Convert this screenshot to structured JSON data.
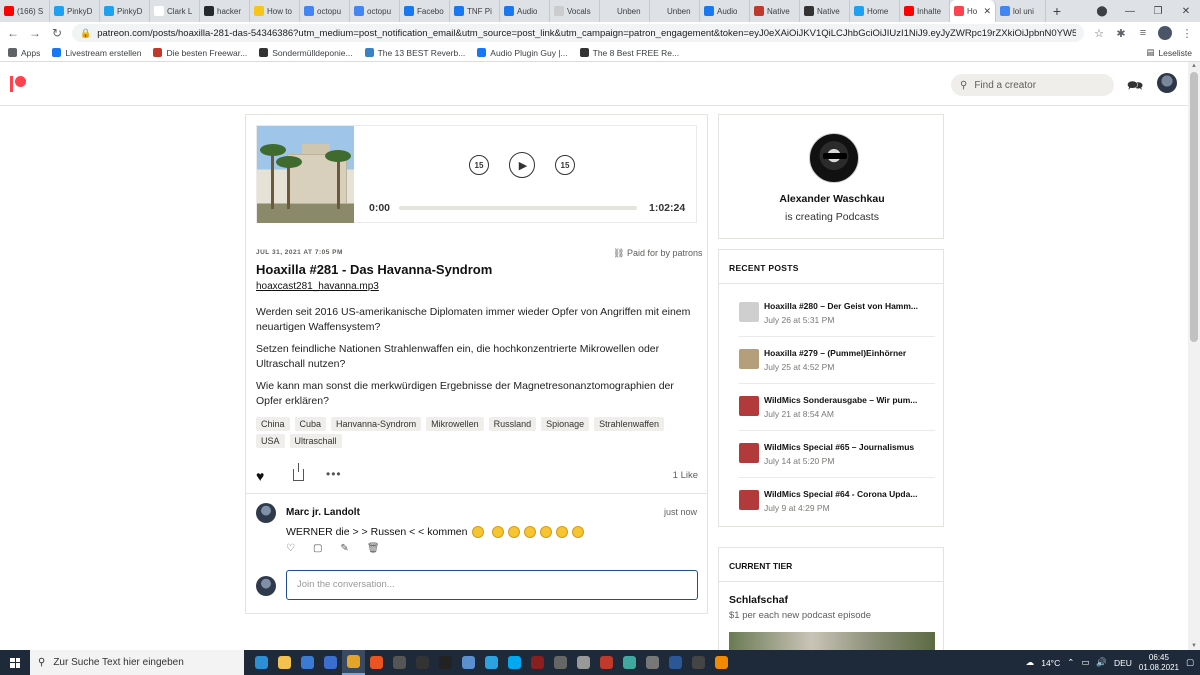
{
  "browser": {
    "tabs": [
      {
        "title": "(166) S",
        "color": "#ff0000"
      },
      {
        "title": "PinkyD",
        "color": "#1da1f2"
      },
      {
        "title": "PinkyD",
        "color": "#1da1f2"
      },
      {
        "title": "Clark L",
        "color": "#ffffff"
      },
      {
        "title": "hacker",
        "color": "#24292e"
      },
      {
        "title": "How to",
        "color": "#f5c518"
      },
      {
        "title": "octopu",
        "color": "#4285f4"
      },
      {
        "title": "octopu",
        "color": "#4285f4"
      },
      {
        "title": "Facebo",
        "color": "#1877f2"
      },
      {
        "title": "TNF Pi",
        "color": "#1877f2"
      },
      {
        "title": "Audio",
        "color": "#1877f2"
      },
      {
        "title": "Vocals",
        "color": "#cccccc"
      },
      {
        "title": "Unben",
        "color": "#dee1e6"
      },
      {
        "title": "Unben",
        "color": "#dee1e6"
      },
      {
        "title": "Audio",
        "color": "#1877f2"
      },
      {
        "title": "Native",
        "color": "#c0392b"
      },
      {
        "title": "Native",
        "color": "#333333"
      },
      {
        "title": "Home",
        "color": "#1da1f2"
      },
      {
        "title": "Inhalte",
        "color": "#ff0000"
      },
      {
        "title": "Ho",
        "color": "#ff424d",
        "active": true
      },
      {
        "title": "lol uni",
        "color": "#4285f4"
      }
    ],
    "new_tab": "+",
    "url": "patreon.com/posts/hoaxilla-281-das-54346386?utm_medium=post_notification_email&utm_source=post_link&utm_campaign=patron_engagement&token=eyJ0eXAiOiJKV1QiLCJhbGciOiJIUzI1NiJ9.eyJyZWRpc19rZXkiOiJpbnN0YW50LWFjY2VzczowNjJmMDU1Ni03...",
    "bookmarks": [
      {
        "label": "Apps",
        "color": "#5f6368"
      },
      {
        "label": "Livestream erstellen",
        "color": "#1877f2"
      },
      {
        "label": "Die besten Freewar...",
        "color": "#c0392b"
      },
      {
        "label": "Sondermülldeponie...",
        "color": "#333333"
      },
      {
        "label": "The 13 BEST Reverb...",
        "color": "#3b82c4"
      },
      {
        "label": "Audio Plugin Guy |...",
        "color": "#1877f2"
      },
      {
        "label": "The 8 Best FREE Re...",
        "color": "#333333"
      }
    ],
    "reading_list": "Leseliste"
  },
  "header": {
    "search_placeholder": "Find a creator"
  },
  "player": {
    "skip_back": "15",
    "skip_forward": "15",
    "current_time": "0:00",
    "duration": "1:02:24",
    "progress": 0
  },
  "post": {
    "date": "JUL 31, 2021 AT 7:05 PM",
    "paid_label": "Paid for by patrons",
    "title": "Hoaxilla #281 - Das Havanna-Syndrom",
    "file": "hoaxcast281_havanna.mp3",
    "paragraphs": [
      "Werden seit 2016 US-amerikanische Diplomaten immer wieder Opfer von Angriffen mit einem neuartigen Waffensystem?",
      "Setzen feindliche Nationen Strahlenwaffen ein, die hochkonzentrierte Mikrowellen oder Ultraschall nutzen?",
      "Wie kann man sonst die merkwürdigen Ergebnisse der Magnetresonanztomographien der Opfer erklären?"
    ],
    "tags": [
      "China",
      "Cuba",
      "Hanvanna-Syndrom",
      "Mikrowellen",
      "Russland",
      "Spionage",
      "Strahlenwaffen",
      "USA",
      "Ultraschall"
    ],
    "likes": "1 Like"
  },
  "comment": {
    "author": "Marc jr. Landolt",
    "time": "just now",
    "text": "WERNER die > > Russen < < kommen",
    "emoji_count": 7,
    "reply_placeholder": "Join the conversation..."
  },
  "creator": {
    "name": "Alexander Waschkau",
    "subtitle": "is creating Podcasts"
  },
  "recent": {
    "heading": "RECENT POSTS",
    "items": [
      {
        "title": "Hoaxilla #280 – Der Geist von Hamm...",
        "date": "July 26 at 5:31 PM",
        "color": "#cfcfcf"
      },
      {
        "title": "Hoaxilla #279 – (Pummel)Einhörner",
        "date": "July 25 at 4:52 PM",
        "color": "#b59f7a"
      },
      {
        "title": "WildMics Sonderausgabe – Wir pum...",
        "date": "July 21 at 8:54 AM",
        "color": "#b23a3a"
      },
      {
        "title": "WildMics Special #65 – Journalismus",
        "date": "July 14 at 5:20 PM",
        "color": "#b23a3a"
      },
      {
        "title": "WildMics Special #64 - Corona Upda...",
        "date": "July 9 at 4:29 PM",
        "color": "#b23a3a"
      }
    ]
  },
  "tier": {
    "heading": "CURRENT TIER",
    "name": "Schlafschaf",
    "price": "$1 per each new podcast episode"
  },
  "taskbar": {
    "search_placeholder": "Zur Suche Text hier eingeben",
    "weather": "14°C",
    "language": "DEU",
    "time": "06:45",
    "date": "01.08.2021",
    "apps": [
      {
        "name": "edge",
        "color": "#2b8fd6"
      },
      {
        "name": "explorer",
        "color": "#f2c14e"
      },
      {
        "name": "store",
        "color": "#3b7bd4"
      },
      {
        "name": "mail",
        "color": "#3a6fd0"
      },
      {
        "name": "chrome",
        "color": "#e2a52a",
        "active": true
      },
      {
        "name": "ubuntu",
        "color": "#e95420"
      },
      {
        "name": "tool",
        "color": "#555555"
      },
      {
        "name": "terminal",
        "color": "#333333"
      },
      {
        "name": "live",
        "color": "#222222"
      },
      {
        "name": "media",
        "color": "#5a8fd0"
      },
      {
        "name": "telegram",
        "color": "#2aa3e0"
      },
      {
        "name": "skype",
        "color": "#00a9f0"
      },
      {
        "name": "monitor",
        "color": "#8a1f1f"
      },
      {
        "name": "kbd",
        "color": "#666666"
      },
      {
        "name": "tools",
        "color": "#999999"
      },
      {
        "name": "red",
        "color": "#c0392b"
      },
      {
        "name": "chat",
        "color": "#3fa9a0"
      },
      {
        "name": "app",
        "color": "#777777"
      },
      {
        "name": "word",
        "color": "#2b5797"
      },
      {
        "name": "obs",
        "color": "#444444"
      },
      {
        "name": "vlc",
        "color": "#f08a00"
      }
    ]
  }
}
